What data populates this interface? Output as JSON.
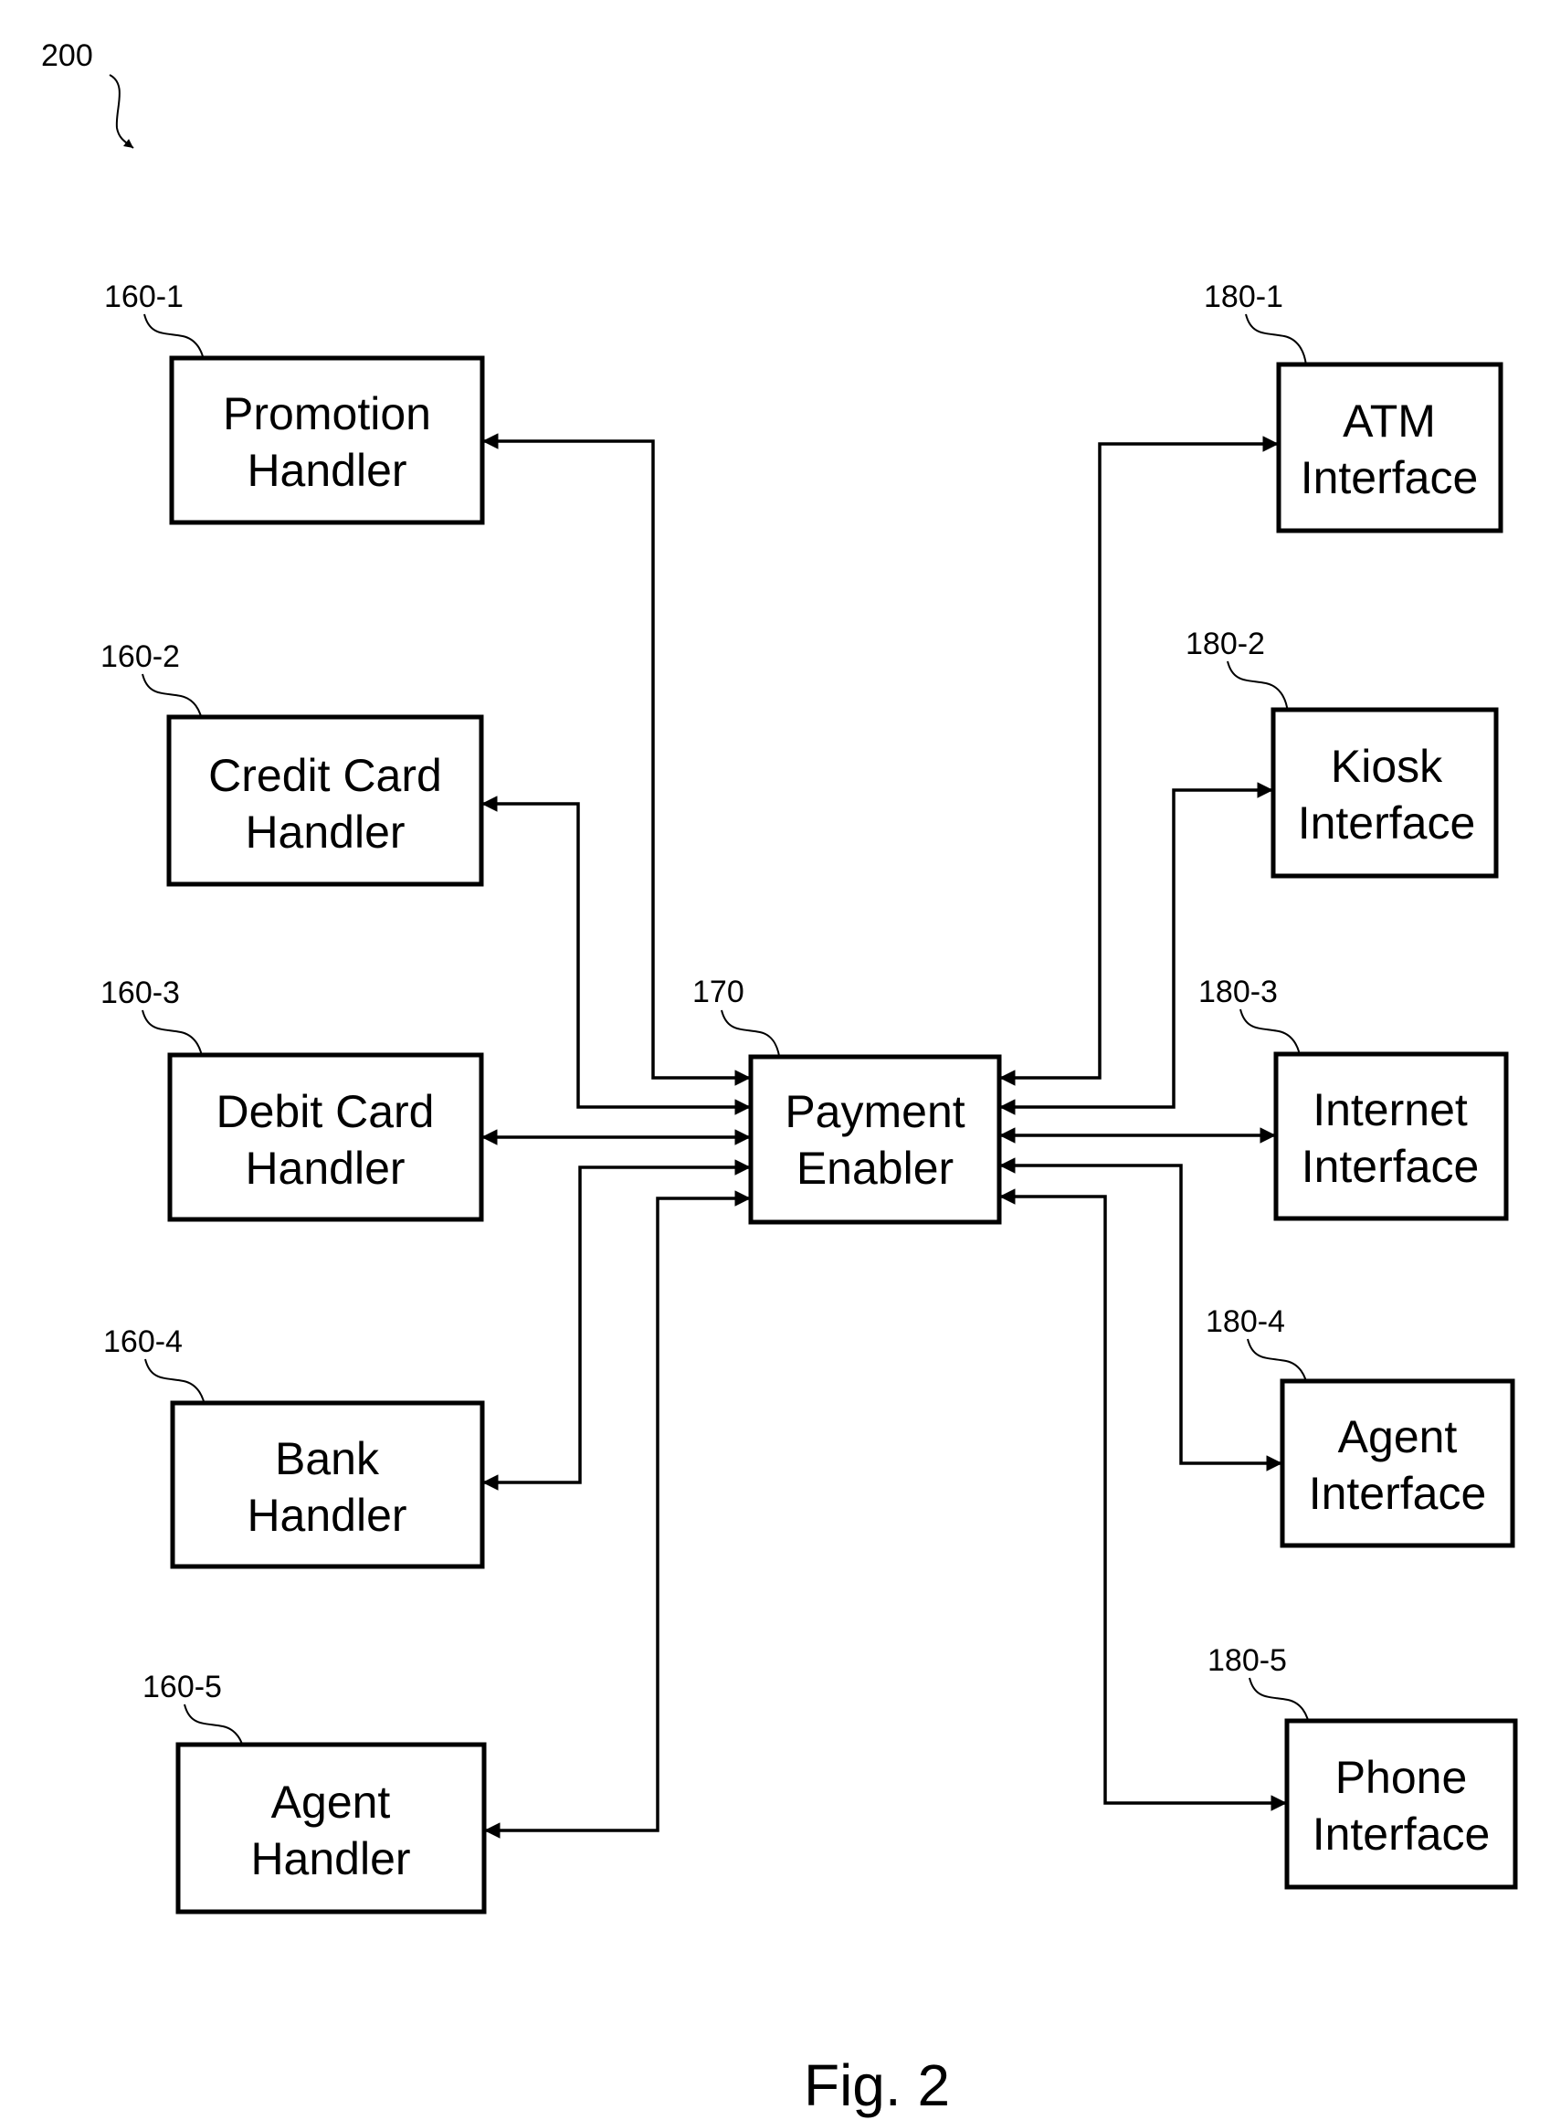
{
  "figure": {
    "ref": "200",
    "caption": "Fig. 2"
  },
  "center": {
    "ref": "170",
    "line1": "Payment",
    "line2": "Enabler"
  },
  "handlers": [
    {
      "ref": "160-1",
      "line1": "Promotion",
      "line2": "Handler"
    },
    {
      "ref": "160-2",
      "line1": "Credit Card",
      "line2": "Handler"
    },
    {
      "ref": "160-3",
      "line1": "Debit Card",
      "line2": "Handler"
    },
    {
      "ref": "160-4",
      "line1": "Bank",
      "line2": "Handler"
    },
    {
      "ref": "160-5",
      "line1": "Agent",
      "line2": "Handler"
    }
  ],
  "interfaces": [
    {
      "ref": "180-1",
      "line1": "ATM",
      "line2": "Interface"
    },
    {
      "ref": "180-2",
      "line1": "Kiosk",
      "line2": "Interface"
    },
    {
      "ref": "180-3",
      "line1": "Internet",
      "line2": "Interface"
    },
    {
      "ref": "180-4",
      "line1": "Agent",
      "line2": "Interface"
    },
    {
      "ref": "180-5",
      "line1": "Phone",
      "line2": "Interface"
    }
  ],
  "colors": {
    "ink": "#000000",
    "paper": "#ffffff"
  }
}
